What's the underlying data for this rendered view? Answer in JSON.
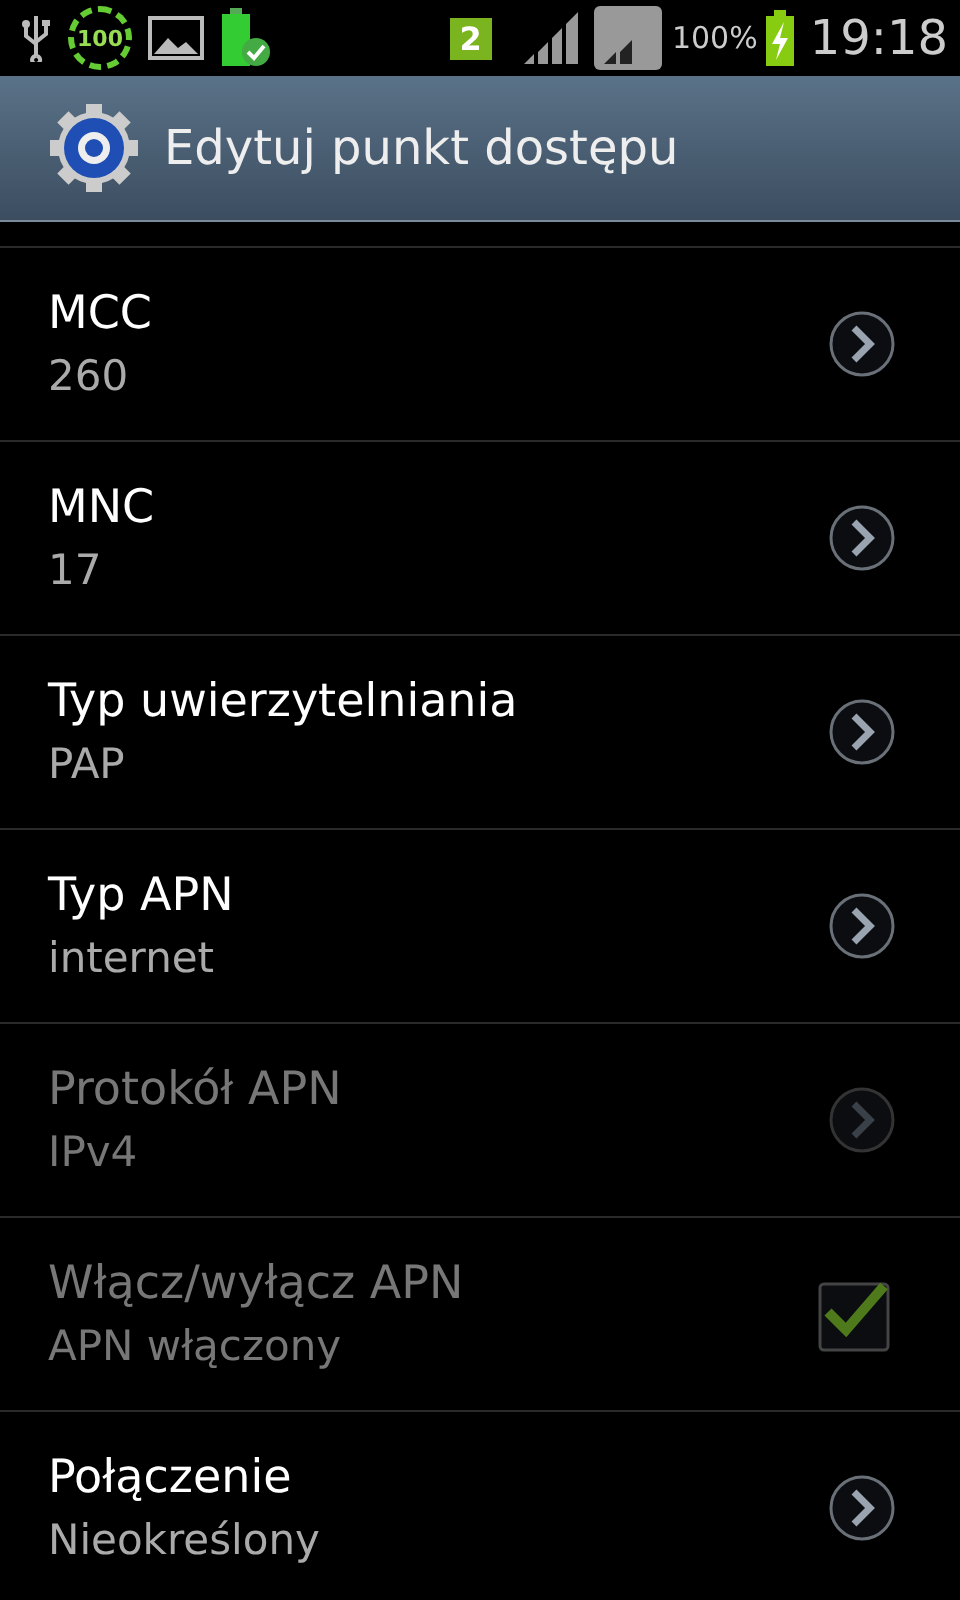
{
  "status_bar": {
    "sync_badge": "100",
    "sim_badge": "2",
    "battery": "100%",
    "time": "19:18"
  },
  "title_bar": {
    "title": "Edytuj punkt dostępu"
  },
  "settings": [
    {
      "kind": "arrow",
      "title": "MCC",
      "value": "260",
      "disabled": false
    },
    {
      "kind": "arrow",
      "title": "MNC",
      "value": "17",
      "disabled": false
    },
    {
      "kind": "arrow",
      "title": "Typ uwierzytelniania",
      "value": "PAP",
      "disabled": false
    },
    {
      "kind": "arrow",
      "title": "Typ APN",
      "value": "internet",
      "disabled": false
    },
    {
      "kind": "arrow",
      "title": "Protokół APN",
      "value": "IPv4",
      "disabled": true
    },
    {
      "kind": "checkbox",
      "title": "Włącz/wyłącz APN",
      "value": "APN włączony",
      "disabled": true,
      "checked": true
    },
    {
      "kind": "arrow",
      "title": "Połączenie",
      "value": "Nieokreślony",
      "disabled": false
    }
  ]
}
